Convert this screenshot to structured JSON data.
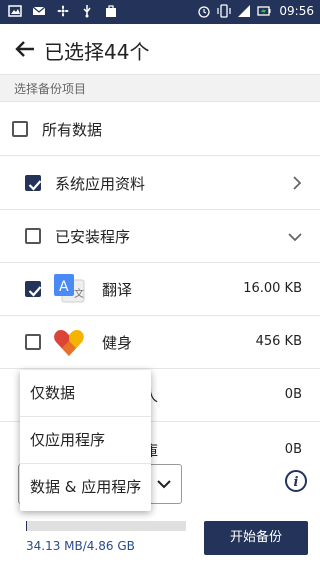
{
  "status_bar": {
    "time": "09:56",
    "left_icons": [
      "image-icon",
      "mail-icon",
      "fan-icon",
      "usb-icon",
      "bag-icon"
    ],
    "right_icons": [
      "alarm-icon",
      "vibrate-icon",
      "signal-icon",
      "battery-charging-icon"
    ]
  },
  "header": {
    "title": "已选择44个"
  },
  "section_label": "选择备份项目",
  "rows": [
    {
      "label": "所有数据",
      "checked": false
    },
    {
      "label": "系统应用资料",
      "checked": true
    },
    {
      "label": "已安装程序",
      "checked": false
    },
    {
      "label": "翻译",
      "size": "16.00 KB",
      "checked": true,
      "icon": "translate-app-icon"
    },
    {
      "label": "健身",
      "size": "456 KB",
      "checked": false,
      "icon": "fitness-heart-icon"
    },
    {
      "label": "拼人",
      "size": "0B",
      "checked": false
    },
    {
      "label": "庫",
      "size": "0B",
      "checked": false
    }
  ],
  "popup": {
    "options": [
      "仅数据",
      "仅应用程序",
      "数据 & 应用程序"
    ]
  },
  "bottom": {
    "storage": "34.13 MB/4.86 GB",
    "progress_fraction": 0.007,
    "start_button": "开始备份"
  },
  "colors": {
    "primary": "#23335a",
    "storage_text": "#2a4c8a"
  }
}
